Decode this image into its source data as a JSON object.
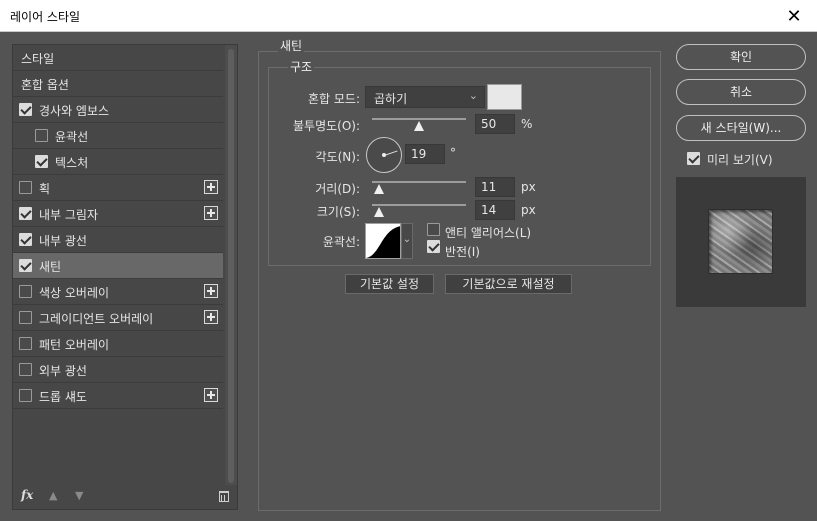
{
  "window": {
    "title": "레이어 스타일",
    "close": "✕"
  },
  "left_panel": {
    "items": [
      {
        "label": "스타일",
        "checkbox": false,
        "checked": false,
        "plus": false,
        "selected": false
      },
      {
        "label": "혼합 옵션",
        "checkbox": false,
        "checked": false,
        "plus": false,
        "selected": false
      },
      {
        "label": "경사와 엠보스",
        "checkbox": true,
        "checked": true,
        "plus": false,
        "selected": false
      },
      {
        "label": "윤곽선",
        "checkbox": true,
        "checked": false,
        "plus": false,
        "selected": false
      },
      {
        "label": "텍스처",
        "checkbox": true,
        "checked": true,
        "plus": false,
        "selected": false
      },
      {
        "label": "획",
        "checkbox": true,
        "checked": false,
        "plus": true,
        "selected": false
      },
      {
        "label": "내부 그림자",
        "checkbox": true,
        "checked": true,
        "plus": true,
        "selected": false
      },
      {
        "label": "내부 광선",
        "checkbox": true,
        "checked": true,
        "plus": false,
        "selected": false
      },
      {
        "label": "새틴",
        "checkbox": true,
        "checked": true,
        "plus": false,
        "selected": true
      },
      {
        "label": "색상 오버레이",
        "checkbox": true,
        "checked": false,
        "plus": true,
        "selected": false
      },
      {
        "label": "그레이디언트 오버레이",
        "checkbox": true,
        "checked": false,
        "plus": true,
        "selected": false
      },
      {
        "label": "패턴 오버레이",
        "checkbox": true,
        "checked": false,
        "plus": false,
        "selected": false
      },
      {
        "label": "외부 광선",
        "checkbox": true,
        "checked": false,
        "plus": false,
        "selected": false
      },
      {
        "label": "드롭 섀도",
        "checkbox": true,
        "checked": false,
        "plus": true,
        "selected": false
      }
    ],
    "fx_label": "fx",
    "up_arrow": "▲",
    "down_arrow": "▼"
  },
  "satin": {
    "section_title": "새틴",
    "structure_title": "구조",
    "blend_mode": {
      "label": "혼합 모드:",
      "value": "곱하기",
      "color": "#e8e8e8"
    },
    "opacity": {
      "label": "불투명도(O):",
      "value": "50",
      "unit": "%",
      "fraction": 0.5
    },
    "angle": {
      "label": "각도(N):",
      "value": "19",
      "unit": "°"
    },
    "distance": {
      "label": "거리(D):",
      "value": "11",
      "unit": "px",
      "fraction": 0.07
    },
    "size": {
      "label": "크기(S):",
      "value": "14",
      "unit": "px",
      "fraction": 0.07
    },
    "contour": {
      "label": "윤곽선:",
      "anti_alias": "앤티 앨리어스(L)",
      "anti_alias_checked": false,
      "invert": "반전(I)",
      "invert_checked": true
    },
    "reset_default": "기본값 설정",
    "restore_default": "기본값으로 재설정"
  },
  "right_panel": {
    "ok": "확인",
    "cancel": "취소",
    "new_style": "새 스타일(W)...",
    "preview_label": "미리 보기(V)",
    "preview_checked": true
  }
}
